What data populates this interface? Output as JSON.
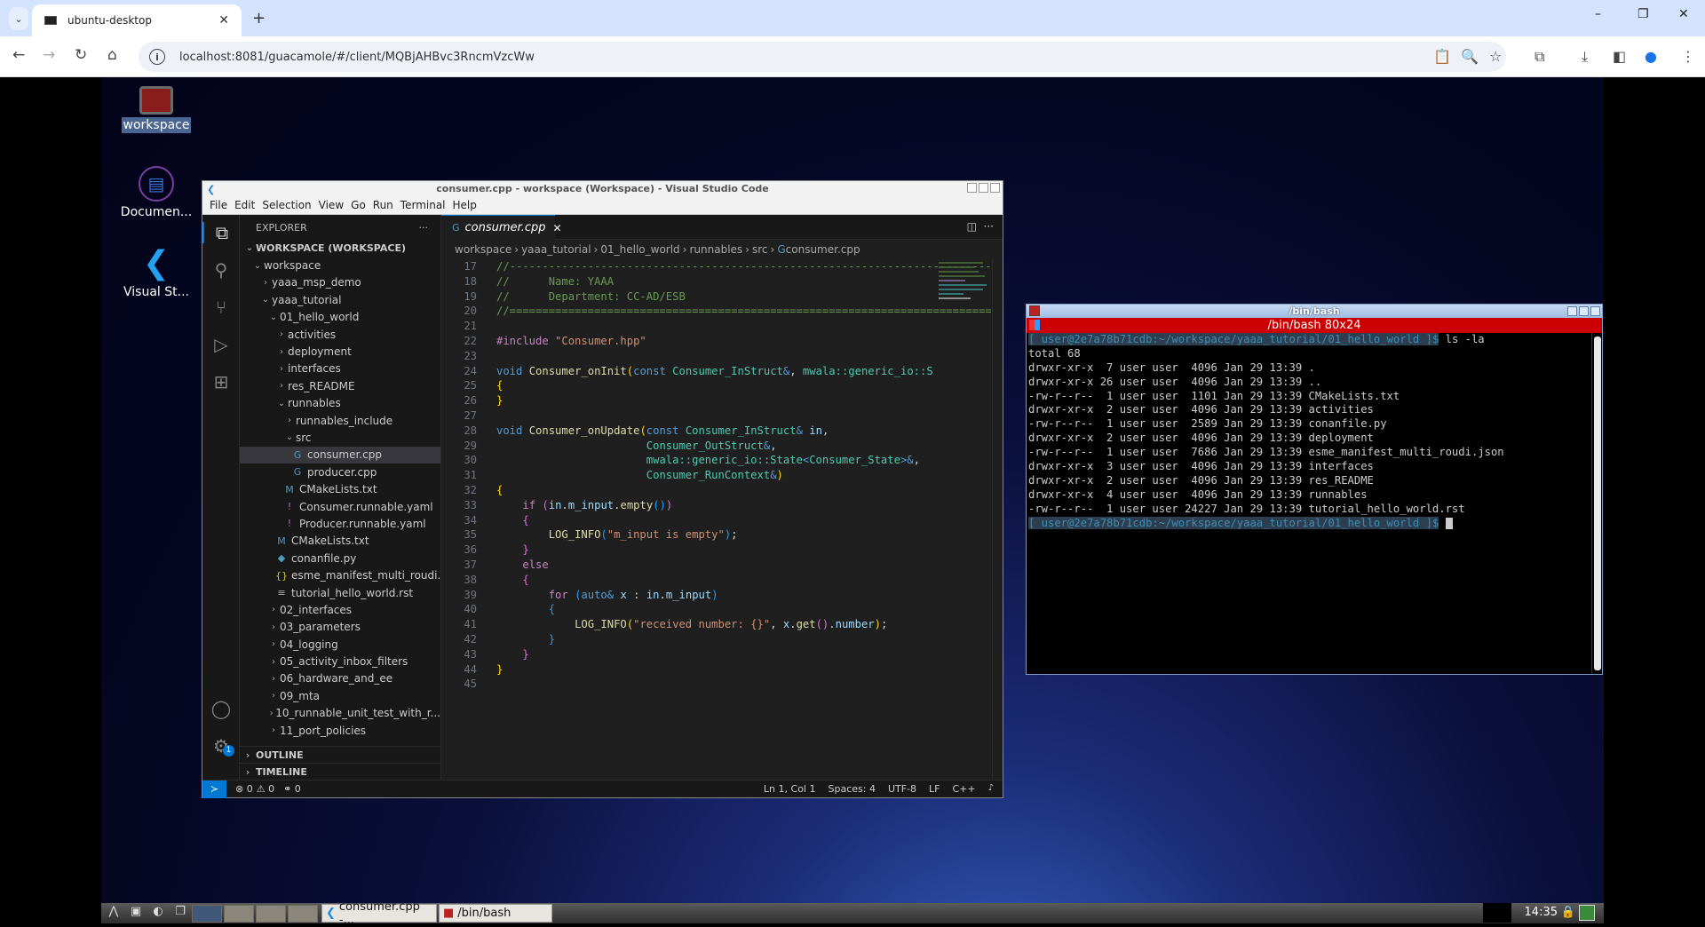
{
  "browser": {
    "tab_title": "ubuntu-desktop",
    "new_tab": "+",
    "url": "localhost:8081/guacamole/#/client/MQBjAHBvc3RncmVzcWw",
    "window_controls": [
      "–",
      "❐",
      "✕"
    ]
  },
  "desktop": {
    "icons": [
      {
        "label": "workspace",
        "icon": "terminal-icon"
      },
      {
        "label": "Documen...",
        "icon": "document-icon"
      },
      {
        "label": "Visual St...",
        "icon": "vscode-icon"
      }
    ]
  },
  "vscode": {
    "title": "consumer.cpp - workspace (Workspace) - Visual Studio Code",
    "menu": [
      "File",
      "Edit",
      "Selection",
      "View",
      "Go",
      "Run",
      "Terminal",
      "Help"
    ],
    "explorer_title": "EXPLORER",
    "explorer_more": "···",
    "tree": [
      {
        "label": "WORKSPACE (WORKSPACE)",
        "depth": 0,
        "chev": "∨",
        "bold": true
      },
      {
        "label": "workspace",
        "depth": 1,
        "chev": "∨"
      },
      {
        "label": "yaaa_msp_demo",
        "depth": 2,
        "chev": ">"
      },
      {
        "label": "yaaa_tutorial",
        "depth": 2,
        "chev": "∨"
      },
      {
        "label": "01_hello_world",
        "depth": 3,
        "chev": "∨"
      },
      {
        "label": "activities",
        "depth": 4,
        "chev": ">"
      },
      {
        "label": "deployment",
        "depth": 4,
        "chev": ">"
      },
      {
        "label": "interfaces",
        "depth": 4,
        "chev": ">"
      },
      {
        "label": "res_README",
        "depth": 4,
        "chev": ">"
      },
      {
        "label": "runnables",
        "depth": 4,
        "chev": "∨"
      },
      {
        "label": "runnables_include",
        "depth": 5,
        "chev": ">"
      },
      {
        "label": "src",
        "depth": 5,
        "chev": "∨"
      },
      {
        "label": "consumer.cpp",
        "depth": 6,
        "icon": "G",
        "icon_color": "#519aba",
        "selected": true
      },
      {
        "label": "producer.cpp",
        "depth": 6,
        "icon": "G",
        "icon_color": "#519aba"
      },
      {
        "label": "CMakeLists.txt",
        "depth": 5,
        "icon": "M",
        "icon_color": "#519aba"
      },
      {
        "label": "Consumer.runnable.yaml",
        "depth": 5,
        "icon": "!",
        "icon_color": "#a074c4"
      },
      {
        "label": "Producer.runnable.yaml",
        "depth": 5,
        "icon": "!",
        "icon_color": "#a074c4"
      },
      {
        "label": "CMakeLists.txt",
        "depth": 4,
        "icon": "M",
        "icon_color": "#519aba"
      },
      {
        "label": "conanfile.py",
        "depth": 4,
        "icon": "◆",
        "icon_color": "#519aba"
      },
      {
        "label": "esme_manifest_multi_roudi....",
        "depth": 4,
        "icon": "{}",
        "icon_color": "#cbcb41"
      },
      {
        "label": "tutorial_hello_world.rst",
        "depth": 4,
        "icon": "≡",
        "icon_color": "#aaaaaa"
      },
      {
        "label": "02_interfaces",
        "depth": 3,
        "chev": ">"
      },
      {
        "label": "03_parameters",
        "depth": 3,
        "chev": ">"
      },
      {
        "label": "04_logging",
        "depth": 3,
        "chev": ">"
      },
      {
        "label": "05_activity_inbox_filters",
        "depth": 3,
        "chev": ">"
      },
      {
        "label": "06_hardware_and_ee",
        "depth": 3,
        "chev": ">"
      },
      {
        "label": "09_mta",
        "depth": 3,
        "chev": ">"
      },
      {
        "label": "10_runnable_unit_test_with_r...",
        "depth": 3,
        "chev": ">"
      },
      {
        "label": "11_port_policies",
        "depth": 3,
        "chev": ">"
      }
    ],
    "panels": [
      "OUTLINE",
      "TIMELINE"
    ],
    "editor_tab": "consumer.cpp",
    "breadcrumb": [
      "workspace",
      "yaaa_tutorial",
      "01_hello_world",
      "runnables",
      "src",
      "consumer.cpp"
    ],
    "code": [
      {
        "n": 17,
        "html": "<span class='c-cm'>//--------------------------------------------------------------------------</span>"
      },
      {
        "n": 18,
        "html": "<span class='c-cm'>//      Name: YAAA</span>"
      },
      {
        "n": 19,
        "html": "<span class='c-cm'>//      Department: CC-AD/ESB</span>"
      },
      {
        "n": 20,
        "html": "<span class='c-cm'>//==========================================================================</span>"
      },
      {
        "n": 21,
        "html": ""
      },
      {
        "n": 22,
        "html": "<span class='c-pp'>#include</span> <span class='c-st'>\"Consumer.hpp\"</span>"
      },
      {
        "n": 23,
        "html": ""
      },
      {
        "n": 24,
        "html": "<span class='c-kw'>void</span> <span class='c-fn'>Consumer_onInit</span><span class='c-br1'>(</span><span class='c-kw'>const</span> <span class='c-ty'>Consumer_InStruct</span><span class='c-kw'>&amp;</span><span class='c-tx'>, </span><span class='c-ty'>mwala::generic_io::S</span>"
      },
      {
        "n": 25,
        "html": "<span class='c-br1'>{</span>"
      },
      {
        "n": 26,
        "html": "<span class='c-br1'>}</span>"
      },
      {
        "n": 27,
        "html": ""
      },
      {
        "n": 28,
        "html": "<span class='c-kw'>void</span> <span class='c-fn'>Consumer_onUpdate</span><span class='c-br1'>(</span><span class='c-kw'>const</span> <span class='c-ty'>Consumer_InStruct</span><span class='c-kw'>&amp;</span> <span class='c-var'>in</span><span class='c-tx'>,</span>"
      },
      {
        "n": 29,
        "html": "                       <span class='c-ty'>Consumer_OutStruct</span><span class='c-kw'>&amp;</span><span class='c-tx'>,</span>"
      },
      {
        "n": 30,
        "html": "                       <span class='c-ty'>mwala::generic_io::State</span><span class='c-kw'>&lt;</span><span class='c-ty'>Consumer_State</span><span class='c-kw'>&gt;&amp;</span><span class='c-tx'>,</span>"
      },
      {
        "n": 31,
        "html": "                       <span class='c-ty'>Consumer_RunContext</span><span class='c-kw'>&amp;</span><span class='c-br1'>)</span>"
      },
      {
        "n": 32,
        "html": "<span class='c-br1'>{</span>"
      },
      {
        "n": 33,
        "html": "    <span class='c-pp'>if</span> <span class='c-br2'>(</span><span class='c-var'>in</span><span class='c-tx'>.</span><span class='c-var'>m_input</span><span class='c-tx'>.</span><span class='c-fn'>empty</span><span class='c-br3'>()</span><span class='c-br2'>)</span>"
      },
      {
        "n": 34,
        "html": "    <span class='c-br2'>{</span>"
      },
      {
        "n": 35,
        "html": "        <span class='c-fn'>LOG_INFO</span><span class='c-br3'>(</span><span class='c-st'>\"m_input is empty\"</span><span class='c-br3'>)</span><span class='c-tx'>;</span>"
      },
      {
        "n": 36,
        "html": "    <span class='c-br2'>}</span>"
      },
      {
        "n": 37,
        "html": "    <span class='c-pp'>else</span>"
      },
      {
        "n": 38,
        "html": "    <span class='c-br2'>{</span>"
      },
      {
        "n": 39,
        "html": "        <span class='c-pp'>for</span> <span class='c-br3'>(</span><span class='c-kw'>auto</span><span class='c-kw'>&amp;</span> <span class='c-var'>x</span> <span class='c-tx'>:</span> <span class='c-var'>in</span><span class='c-tx'>.</span><span class='c-var'>m_input</span><span class='c-br3'>)</span>"
      },
      {
        "n": 40,
        "html": "        <span class='c-br3'>{</span>"
      },
      {
        "n": 41,
        "html": "            <span class='c-fn'>LOG_INFO</span><span class='c-br1'>(</span><span class='c-st'>\"received number: {}\"</span><span class='c-tx'>, </span><span class='c-var'>x</span><span class='c-tx'>.</span><span class='c-fn'>get</span><span class='c-br2'>()</span><span class='c-tx'>.</span><span class='c-var'>number</span><span class='c-br1'>)</span><span class='c-tx'>;</span>"
      },
      {
        "n": 42,
        "html": "        <span class='c-br3'>}</span>"
      },
      {
        "n": 43,
        "html": "    <span class='c-br2'>}</span>"
      },
      {
        "n": 44,
        "html": "<span class='c-br1'>}</span>"
      },
      {
        "n": 45,
        "html": ""
      }
    ],
    "status": {
      "errors": "⊗ 0",
      "warnings": "⚠ 0",
      "ports": "⚭ 0",
      "position": "Ln 1, Col 1",
      "spaces": "Spaces: 4",
      "encoding": "UTF-8",
      "eol": "LF",
      "language": "C++",
      "bell": "🔔"
    },
    "settings_badge": "1"
  },
  "terminal": {
    "window_title": "/bin/bash",
    "inner_title": "/bin/bash 80x24",
    "prompt": "[ user@2e7a78b71cdb:~/workspace/yaaa_tutorial/01_hello_world ]$",
    "command": " ls -la",
    "lines": [
      "total 68",
      "drwxr-xr-x  7 user user  4096 Jan 29 13:39 .",
      "drwxr-xr-x 26 user user  4096 Jan 29 13:39 ..",
      "-rw-r--r--  1 user user  1101 Jan 29 13:39 CMakeLists.txt",
      "drwxr-xr-x  2 user user  4096 Jan 29 13:39 activities",
      "-rw-r--r--  1 user user  2589 Jan 29 13:39 conanfile.py",
      "drwxr-xr-x  2 user user  4096 Jan 29 13:39 deployment",
      "-rw-r--r--  1 user user  7686 Jan 29 13:39 esme_manifest_multi_roudi.json",
      "drwxr-xr-x  3 user user  4096 Jan 29 13:39 interfaces",
      "drwxr-xr-x  2 user user  4096 Jan 29 13:39 res_README",
      "drwxr-xr-x  4 user user  4096 Jan 29 13:39 runnables",
      "-rw-r--r--  1 user user 24227 Jan 29 13:39 tutorial_hello_world.rst"
    ]
  },
  "taskbar": {
    "tasks": [
      "consumer.cpp -...",
      "/bin/bash"
    ],
    "clock": "14:35"
  }
}
